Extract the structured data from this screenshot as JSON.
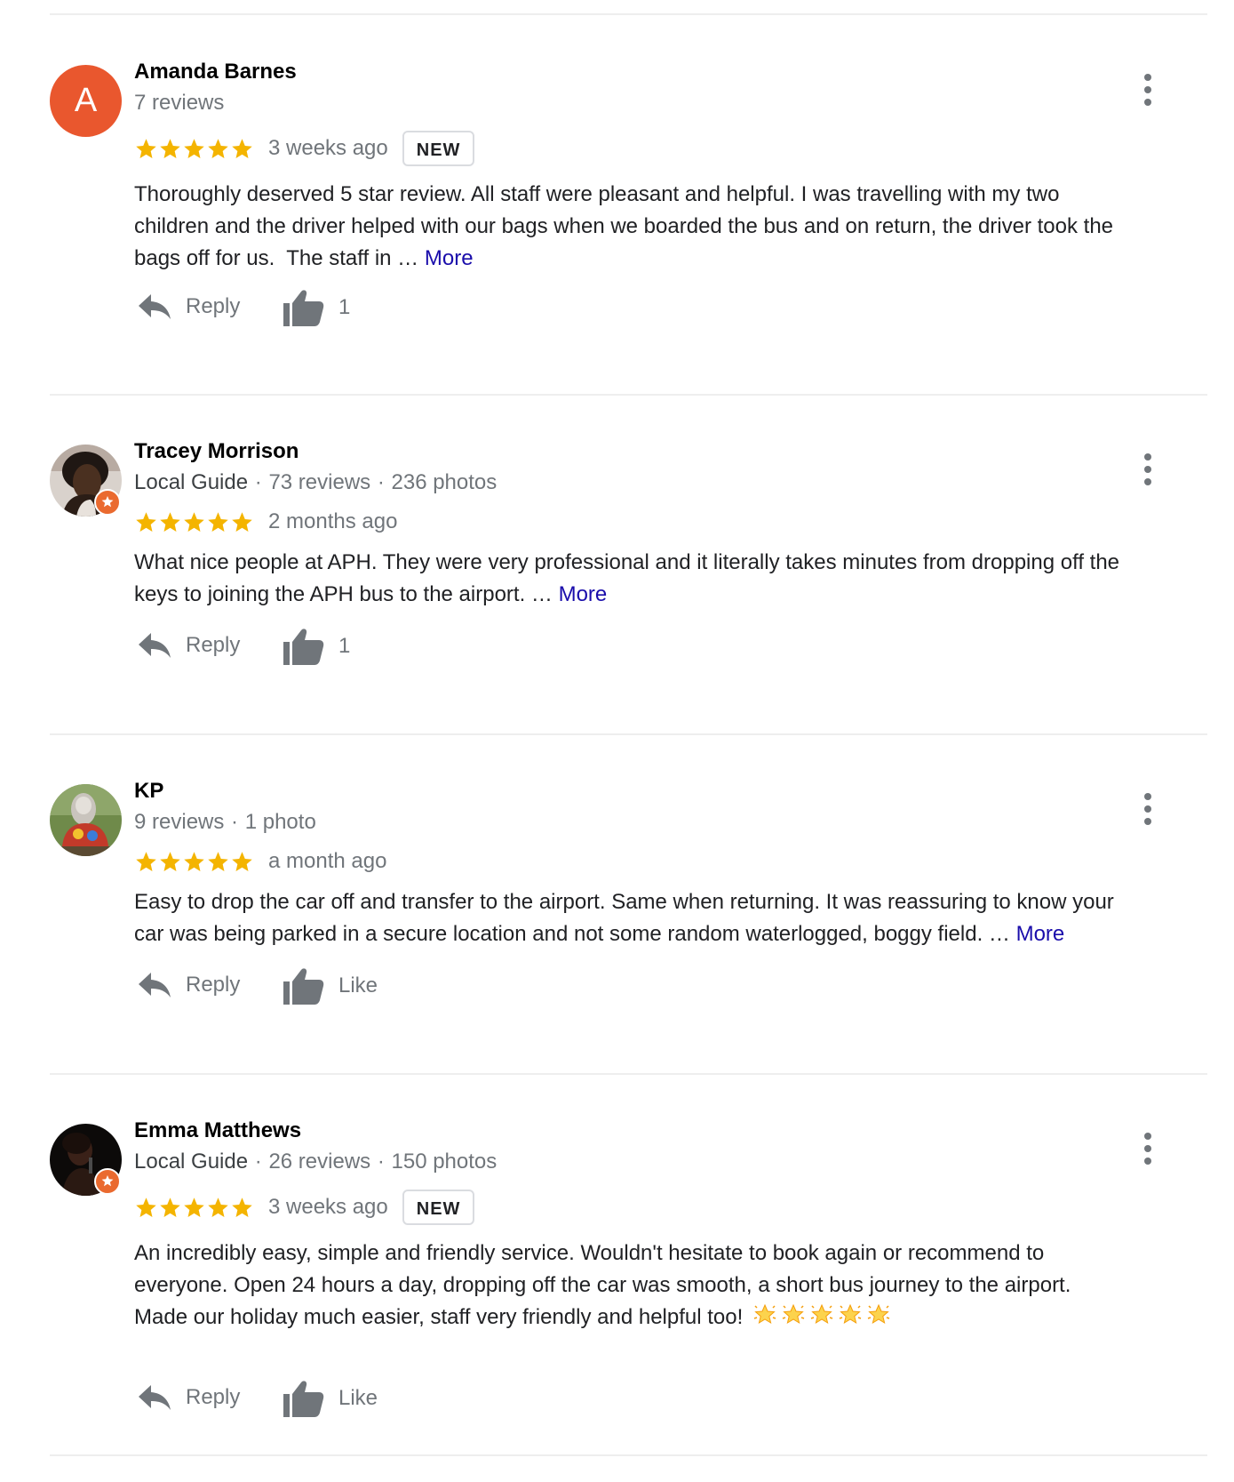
{
  "reviews": [
    {
      "name": "Amanda Barnes",
      "avatar_letter": "A",
      "avatar_type": "letter",
      "avatar_color": "#e9572e",
      "local_guide": false,
      "meta": "7 reviews",
      "rating": 5,
      "time": "3 weeks ago",
      "badge": "NEW",
      "text_lines": [
        "Thoroughly deserved 5 star review.  All staff were pleasant and helpful.  I was travelling with my two",
        "children and the driver helped with our bags when we boarded the bus and on return, the driver took the",
        "bags off for us.  The staff in … "
      ],
      "more": "More",
      "reply_label": "Reply",
      "like_label": "1"
    },
    {
      "name": "Tracey Morrison",
      "avatar_type": "photo",
      "local_guide": true,
      "guide_label": "Local Guide",
      "meta": "73 reviews",
      "meta2": "236 photos",
      "rating": 5,
      "time": "2 months ago",
      "text_lines": [
        "What nice people at APH. They were very professional and it literally takes minutes from dropping off the",
        "keys to joining the APH bus to the airport. … "
      ],
      "more": "More",
      "reply_label": "Reply",
      "like_label": "1"
    },
    {
      "name": "KP",
      "avatar_type": "photo",
      "local_guide": false,
      "meta": "9 reviews",
      "meta2": "1 photo",
      "rating": 5,
      "time": "a month ago",
      "text_lines": [
        "Easy to drop the car off and transfer to the airport. Same when returning. It was reassuring to know your",
        "car was being parked in a secure location and not some random waterlogged, boggy field. … "
      ],
      "more": "More",
      "reply_label": "Reply",
      "like_label": "Like"
    },
    {
      "name": "Emma Matthews",
      "avatar_type": "photo",
      "local_guide": true,
      "guide_label": "Local Guide",
      "meta": "26 reviews",
      "meta2": "150 photos",
      "rating": 5,
      "time": "3 weeks ago",
      "badge": "NEW",
      "text_lines": [
        "An incredibly easy, simple and friendly service. Wouldn't hesitate to book again or recommend to",
        "everyone. Open 24 hours a day, dropping off the car was smooth, a short bus journey to the airport.",
        "Made our holiday much easier, staff very friendly and helpful too! "
      ],
      "emoji_count": 5,
      "reply_label": "Reply",
      "like_label": "Like"
    }
  ],
  "colors": {
    "star": "#f4b400",
    "link": "#1a0dab",
    "secondary_text": "#70757a",
    "icon": "#70757a",
    "local_guide_badge": "#ea6a2f"
  },
  "icons": [
    "star-icon",
    "kebab-menu-icon",
    "reply-icon",
    "thumbs-up-icon",
    "local-guide-badge-icon",
    "glowing-star-emoji"
  ]
}
